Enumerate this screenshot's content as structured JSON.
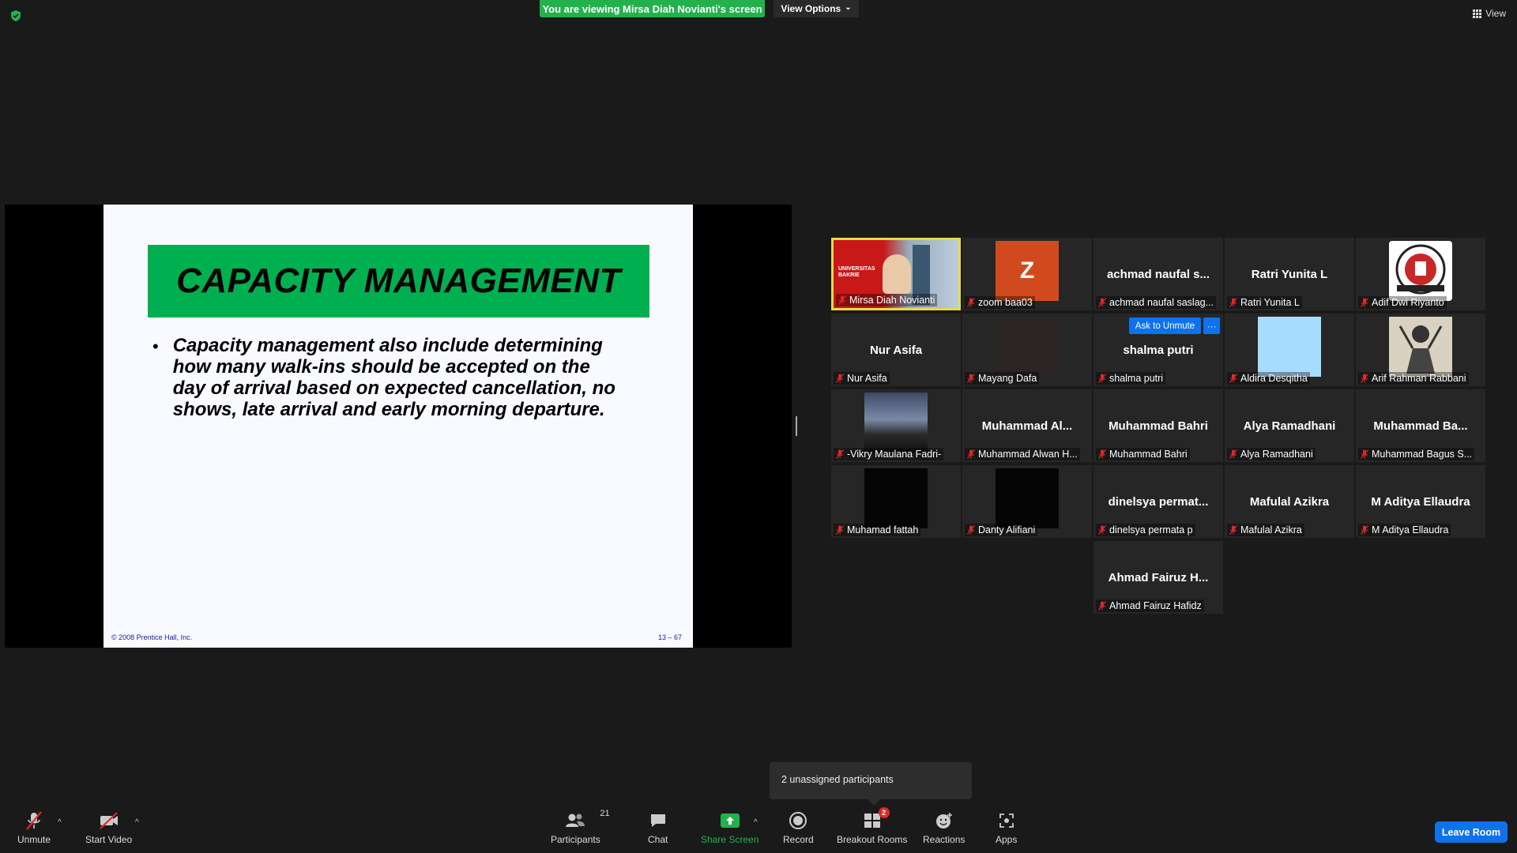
{
  "banner": {
    "text": "You are viewing Mirsa Diah Novianti's screen",
    "color": "#23b14d"
  },
  "view_options": {
    "label": "View Options",
    "caret": "⌄"
  },
  "view_button": {
    "label": "View",
    "icon": "grid-icon"
  },
  "slide": {
    "title": "CAPACITY MANAGEMENT",
    "title_bg": "#00b050",
    "bullet": "•",
    "body_lines": [
      "Capacity management also include determining",
      "how many walk-ins should be accepted on the",
      "day of arrival based on expected cancellation, no",
      "shows, late arrival and early morning departure."
    ],
    "copyright": "© 2008 Prentice Hall, Inc.",
    "page": "13 – 67"
  },
  "participants": [
    {
      "label": "Mirsa Diah Novianti",
      "name": "",
      "kind": "video-red",
      "active": true
    },
    {
      "label": "zoom baa03",
      "name": "",
      "kind": "avatar-z",
      "avatar_letter": "Z",
      "avatar_color": "#d14a1e"
    },
    {
      "label": "achmad naufal saslag...",
      "name": "achmad  naufal  s...",
      "kind": "name"
    },
    {
      "label": "Ratri Yunita L",
      "name": "Ratri Yunita L",
      "kind": "name"
    },
    {
      "label": "Adif Dwi Riyanto",
      "name": "",
      "kind": "logo"
    },
    {
      "label": "Nur Asifa",
      "name": "Nur Asifa",
      "kind": "name"
    },
    {
      "label": "Mayang Dafa",
      "name": "",
      "kind": "dark"
    },
    {
      "label": "shalma putri",
      "name": "shalma putri",
      "kind": "name"
    },
    {
      "label": "Aldira Desqitha",
      "name": "",
      "kind": "lightblue"
    },
    {
      "label": "Arif Rahman Rabbani",
      "name": "",
      "kind": "sketch"
    },
    {
      "label": "-Vikry Maulana Fadri-",
      "name": "",
      "kind": "sunset"
    },
    {
      "label": "Muhammad Alwan H...",
      "name": "Muhammad  Al...",
      "kind": "name"
    },
    {
      "label": "Muhammad Bahri",
      "name": "Muhammad Bahri",
      "kind": "name"
    },
    {
      "label": "Alya Ramadhani",
      "name": "Alya Ramadhani",
      "kind": "name"
    },
    {
      "label": "Muhammad Bagus S...",
      "name": "Muhammad  Ba...",
      "kind": "name"
    },
    {
      "label": "Muhamad fattah",
      "name": "",
      "kind": "black"
    },
    {
      "label": "Danty Alifiani",
      "name": "",
      "kind": "black"
    },
    {
      "label": "dinelsya permata p",
      "name": "dinelsya  permat...",
      "kind": "name"
    },
    {
      "label": "Mafulal Azikra",
      "name": "Mafulal Azikra",
      "kind": "name"
    },
    {
      "label": "M Aditya Ellaudra",
      "name": "M Aditya Ellaudra",
      "kind": "name"
    },
    {
      "label": "Ahmad Fairuz Hafidz",
      "name": "Ahmad Fairuz H...",
      "kind": "name"
    }
  ],
  "tile_video_text": {
    "university": "UNIVERSITAS",
    "university2": "BAKRIE"
  },
  "hover_actions": {
    "ask_unmute": "Ask to Unmute",
    "more": "···"
  },
  "unassigned": {
    "text": "2 unassigned participants"
  },
  "toolbar": {
    "unmute": "Unmute",
    "start_video": "Start Video",
    "participants": "Participants",
    "participants_count": "21",
    "chat": "Chat",
    "share_screen": "Share Screen",
    "record": "Record",
    "breakout_rooms": "Breakout Rooms",
    "breakout_badge": "2",
    "reactions": "Reactions",
    "apps": "Apps",
    "leave_room": "Leave Room",
    "share_color": "#23b14d",
    "leave_color": "#0e72ed"
  }
}
